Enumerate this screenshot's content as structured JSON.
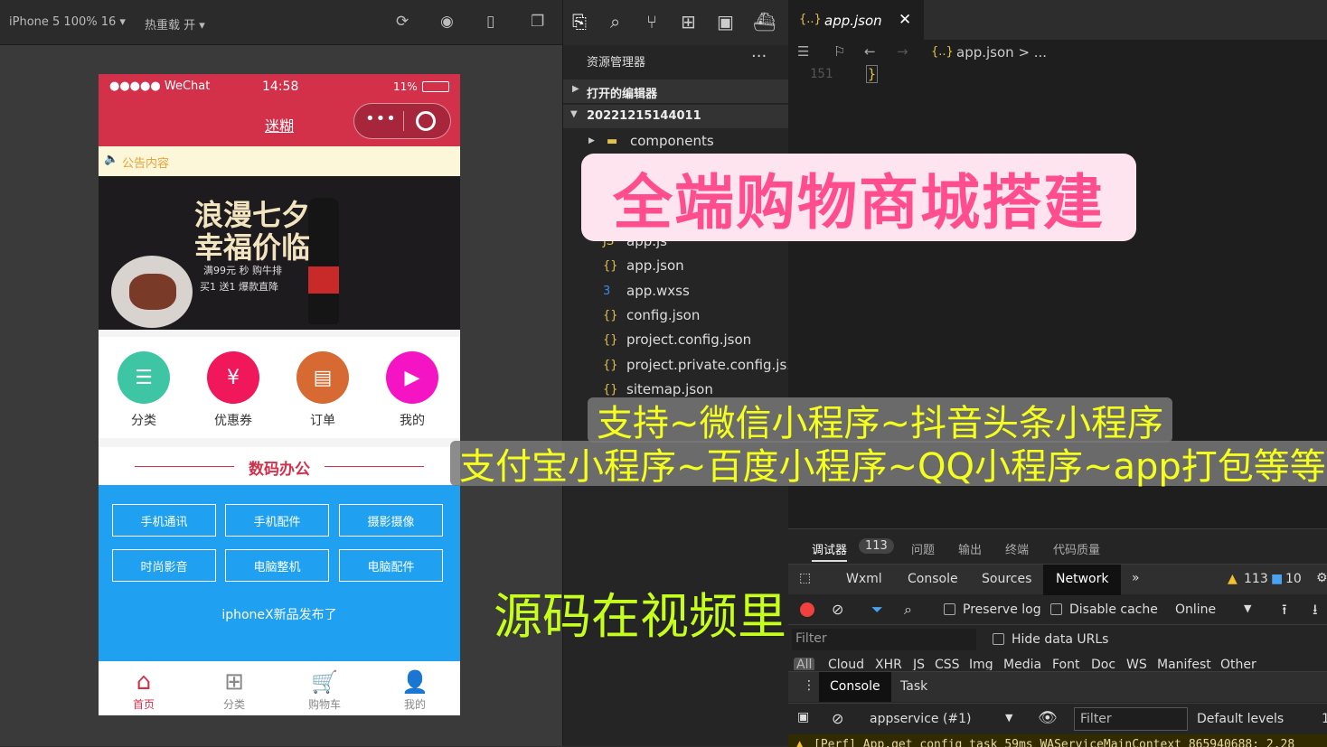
{
  "sim_toolbar": {
    "device": "iPhone 5 100% 16 ▾",
    "hot_reload": "热重载 开 ▾"
  },
  "phone": {
    "status": {
      "carrier": "●●●●● WeChat",
      "time": "14:58",
      "battery": "11%"
    },
    "nav_title": "迷糊",
    "notice": "公告内容",
    "banner": {
      "headline1": "浪漫七夕",
      "headline2": "幸福价临",
      "line1": "满99元 秒 购牛排",
      "line2": "买1 送1 爆款直降"
    },
    "categories": [
      {
        "label": "分类",
        "color": "#3ec6a4"
      },
      {
        "label": "优惠券",
        "color": "#f0175a"
      },
      {
        "label": "订单",
        "color": "#d76a33"
      },
      {
        "label": "我的",
        "color": "#f514c4"
      }
    ],
    "section_title": "数码办公",
    "tags": [
      "手机通讯",
      "手机配件",
      "摄影摄像",
      "时尚影音",
      "电脑整机",
      "电脑配件"
    ],
    "news": "iphoneX新品发布了",
    "tabs": [
      {
        "label": "首页",
        "active": true
      },
      {
        "label": "分类"
      },
      {
        "label": "购物车"
      },
      {
        "label": "我的"
      }
    ]
  },
  "explorer": {
    "title": "资源管理器",
    "open_editors": "打开的编辑器",
    "project": "20221215144011",
    "files": [
      "components",
      "app.js",
      "app.json",
      "app.wxss",
      "config.json",
      "project.config.json",
      "project.private.config.js...",
      "sitemap.json"
    ]
  },
  "editor": {
    "tab": "app.json",
    "breadcrumb": "app.json > ...",
    "line_no": "151",
    "code": "}"
  },
  "devtools": {
    "tabs": [
      "调试器",
      "问题",
      "输出",
      "终端",
      "代码质量"
    ],
    "badge": "113",
    "panels": [
      "Wxml",
      "Console",
      "Sources",
      "Network"
    ],
    "warnings": "113",
    "infos": "10",
    "preserve_log": "Preserve log",
    "disable_cache": "Disable cache",
    "throttle": "Online",
    "filter": "Filter",
    "hide_data_urls": "Hide data URLs",
    "types": [
      "All",
      "Cloud",
      "XHR",
      "JS",
      "CSS",
      "Img",
      "Media",
      "Font",
      "Doc",
      "WS",
      "Manifest",
      "Other"
    ],
    "drawer_tabs": [
      "Console",
      "Task"
    ],
    "context": "appservice (#1)",
    "filter2": "Filter",
    "levels": "Default levels",
    "log": "[Perf] App.get config task 59ms WAServiceMainContext 865940688: 2.28"
  },
  "overlay": {
    "promo": "全端购物商城搭建",
    "band1": "支持~微信小程序~抖音头条小程序",
    "band2": "支付宝小程序~百度小程序~QQ小程序~app打包等等",
    "source": "源码在视频里"
  }
}
